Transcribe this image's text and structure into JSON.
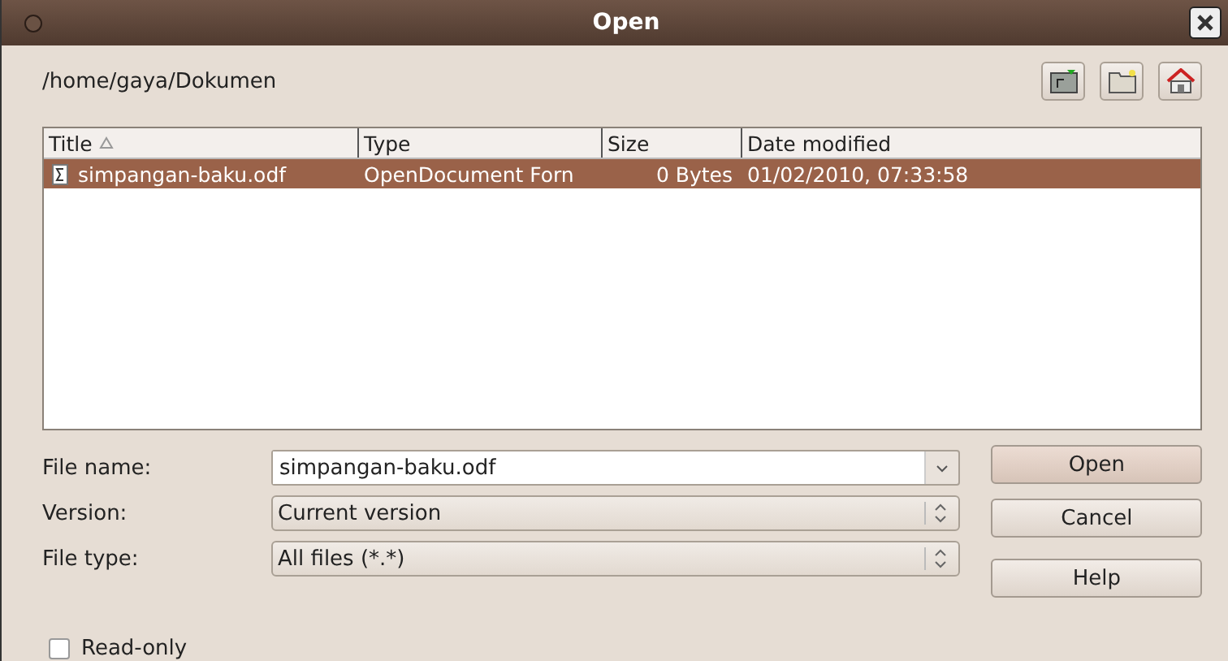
{
  "window": {
    "title": "Open"
  },
  "path": "/home/gaya/Dokumen",
  "table": {
    "columns": [
      {
        "label": "Title",
        "sorted": true
      },
      {
        "label": "Type",
        "sorted": false
      },
      {
        "label": "Size",
        "sorted": false
      },
      {
        "label": "Date modified",
        "sorted": false
      }
    ],
    "rows": [
      {
        "selected": true,
        "cells": [
          "simpangan-baku.odf",
          "OpenDocument Forn",
          "0 Bytes",
          "01/02/2010, 07:33:58"
        ]
      }
    ]
  },
  "fields": [
    {
      "label": "File name:",
      "kind": "combo-entry",
      "value": "simpangan-baku.odf"
    },
    {
      "label": "Version:",
      "kind": "select",
      "value": "Current version"
    },
    {
      "label": "File type:",
      "kind": "select",
      "value": "All files (*.*)"
    }
  ],
  "buttons": [
    {
      "label": "Open",
      "default": true
    },
    {
      "label": "Cancel",
      "default": false
    },
    {
      "label": "Help",
      "default": false
    }
  ],
  "read_only": {
    "label": "Read-only",
    "checked": false
  }
}
